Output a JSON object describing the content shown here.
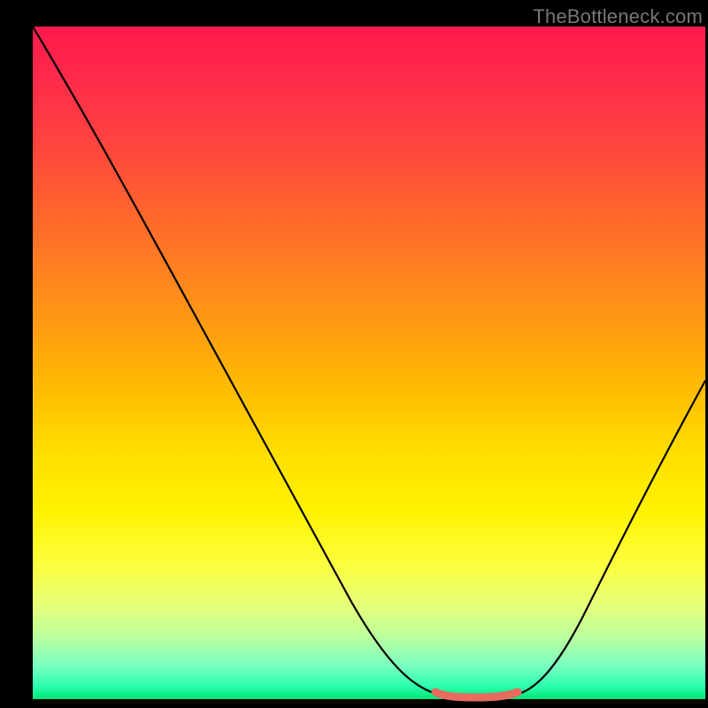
{
  "watermark": "TheBottleneck.com",
  "colors": {
    "frame": "#000000",
    "curve_stroke": "#000000",
    "accent_mark": "#e96a5f",
    "gradient_top": "#ff1a4d",
    "gradient_bottom": "#00e676"
  },
  "chart_data": {
    "type": "line",
    "title": "",
    "xlabel": "",
    "ylabel": "",
    "xlim": [
      0,
      100
    ],
    "ylim": [
      0,
      100
    ],
    "x": [
      0,
      5,
      10,
      15,
      20,
      25,
      30,
      35,
      40,
      45,
      50,
      55,
      60,
      62,
      64,
      66,
      68,
      70,
      72,
      75,
      80,
      85,
      90,
      95,
      100
    ],
    "values": [
      100,
      92,
      84,
      76,
      68,
      60,
      52,
      44,
      36,
      28,
      20,
      12,
      4,
      0.5,
      0,
      0,
      0,
      0,
      0.5,
      3,
      11,
      21,
      32,
      44,
      56
    ],
    "accent_region_x": [
      60,
      72
    ],
    "note": "Values are percentage heights read from the visual; 0 = bottom (green), 100 = top (red). Curve descends from top-left to a flat minimum near x≈62–72, then rises toward the right edge reaching about mid-height."
  }
}
